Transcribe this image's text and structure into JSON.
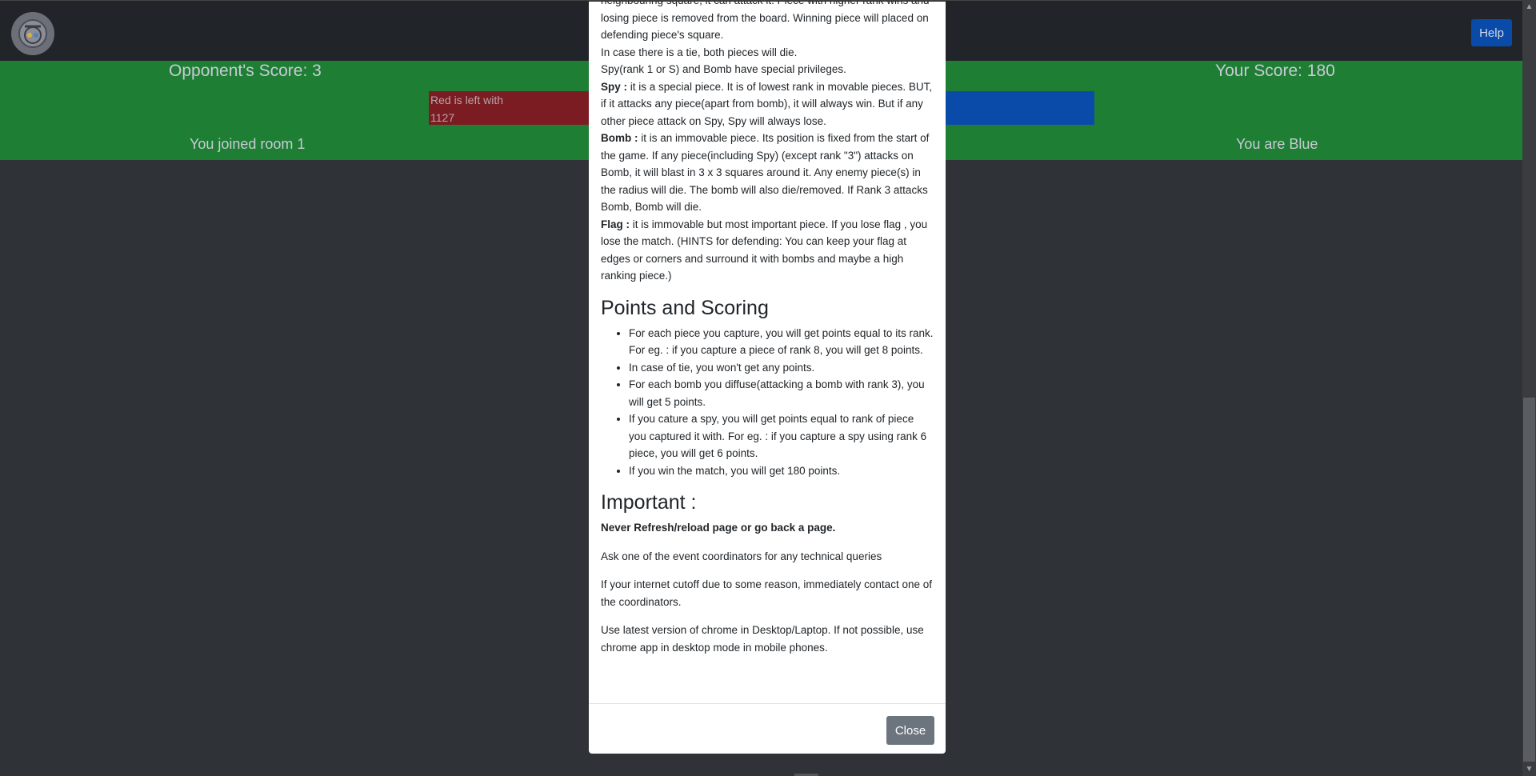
{
  "navbar": {
    "help_label": "Help",
    "logo_icon": "logo-icon"
  },
  "status": {
    "opponent_score": "Opponent's Score: 3",
    "your_score": "Your Score: 180",
    "joined_text": "You joined room 1",
    "color_text": "You are Blue",
    "red_bar_text_line1": "Red is left with",
    "red_bar_text_line2": "1127",
    "colors": {
      "green": "#1e7e34",
      "red": "#7a1c22",
      "blue": "#0a4aa8"
    }
  },
  "modal": {
    "intro_lines": [
      "neighbouring square, it can attack it. Piece with higher rank wins and losing piece is removed from the board. Winning piece will placed on defending piece's square.",
      "In case there is a tie, both pieces will die.",
      "Spy(rank 1 or S) and Bomb have special privileges."
    ],
    "spy_label": "Spy :",
    "spy_text": " it is a special piece. It is of lowest rank in movable pieces. BUT, if it attacks any piece(apart from bomb), it will always win. But if any other piece attack on Spy, Spy will always lose.",
    "bomb_label": "Bomb :",
    "bomb_text": " it is an immovable piece. Its position is fixed from the start of the game. If any piece(including Spy) (except rank \"3\") attacks on Bomb, it will blast in 3 x 3 squares around it. Any enemy piece(s) in the radius will die. The bomb will also die/removed. If Rank 3 attacks Bomb, Bomb will die.",
    "flag_label": "Flag :",
    "flag_text": " it is immovable but most important piece. If you lose flag , you lose the match. (HINTS for defending: You can keep your flag at edges or corners and surround it with bombs and maybe a high ranking piece.)",
    "scoring_heading": "Points and Scoring",
    "scoring_items": [
      "For each piece you capture, you will get points equal to its rank. For eg. : if you capture a piece of rank 8, you will get 8 points.",
      "In case of tie, you won't get any points.",
      "For each bomb you diffuse(attacking a bomb with rank 3), you will get 5 points.",
      "If you cature a spy, you will get points equal to rank of piece you captured it with. For eg. : if you capture a spy using rank 6 piece, you will get 6 points.",
      "If you win the match, you will get 180 points."
    ],
    "important_heading": "Important :",
    "important_strong": "Never Refresh/reload page or go back a page.",
    "important_lines": [
      "Ask one of the event coordinators for any technical queries",
      "If your internet cutoff due to some reason, immediately contact one of the coordinators.",
      "Use latest version of chrome in Desktop/Laptop. If not possible, use chrome app in desktop mode in mobile phones."
    ],
    "close_label": "Close"
  }
}
